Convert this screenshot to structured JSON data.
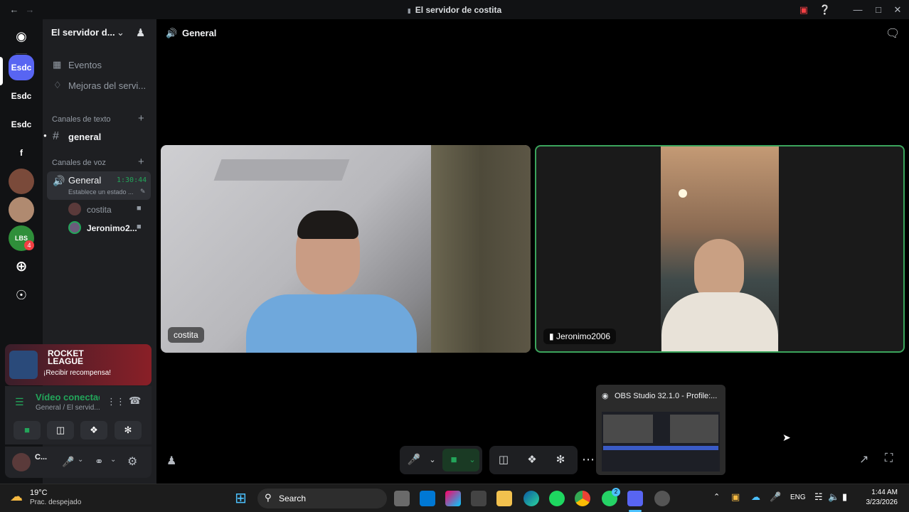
{
  "window": {
    "title": "El servidor de costita"
  },
  "servers": [
    {
      "label": "Esdc",
      "color": "#5865f2"
    },
    {
      "label": "Esdc"
    },
    {
      "label": "Esdc"
    },
    {
      "label": "f"
    }
  ],
  "server_badges": {
    "lbs_count": "4"
  },
  "sidebar": {
    "server_name": "El servidor d...",
    "events": "Eventos",
    "boosts": "Mejoras del servi...",
    "text_category": "Canales de texto",
    "text_channel": "general",
    "voice_category": "Canales de voz",
    "voice_channel": "General",
    "voice_timer": "1:30:44",
    "voice_status": "Establece un estado ...",
    "members": [
      "costita",
      "Jeronimo2..."
    ]
  },
  "rocket_league": {
    "logo_text_1": "ROCKET",
    "logo_text_2": "LEAGUE",
    "reward": "¡Recibir recompensa!"
  },
  "voice_panel": {
    "status": "Vídeo conectad",
    "location": "General / El servid..."
  },
  "user_panel": {
    "name": "C...",
    "sub": " "
  },
  "header": {
    "channel": "General"
  },
  "tiles": [
    {
      "name": "costita"
    },
    {
      "name": "Jeronimo2006",
      "speaking_color": "#3ba55c"
    }
  ],
  "obs_preview": {
    "title": "OBS Studio 32.1.0 - Profile:..."
  },
  "taskbar": {
    "weather_temp": "19°C",
    "weather_desc": "Prac. despejado",
    "search": "Search",
    "lang": "ENG",
    "time": "1:44 AM",
    "date": "3/23/2026",
    "whatsapp_badge": "2"
  },
  "colors": {
    "accent": "#5865f2",
    "green": "#23a55a",
    "speaking": "#3ba55c"
  }
}
